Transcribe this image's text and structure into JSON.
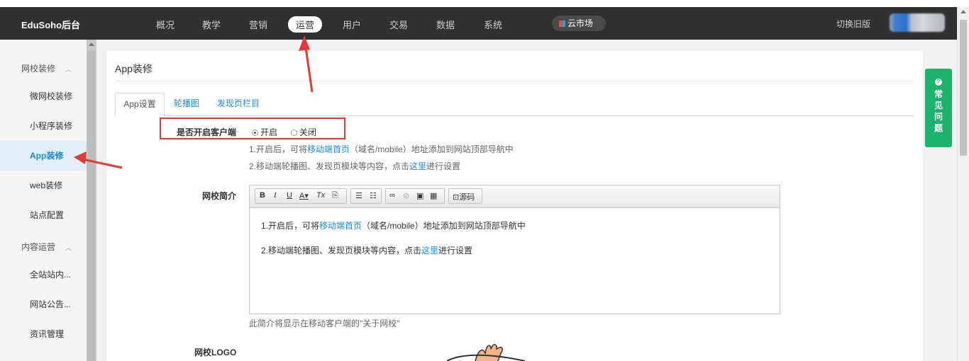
{
  "navbar": {
    "brand": "EduSoho后台",
    "items": [
      "概况",
      "教学",
      "营销",
      "运营",
      "用户",
      "交易",
      "数据",
      "系统"
    ],
    "active": "运营",
    "market": "云市场",
    "switch_old": "切换旧版"
  },
  "sidebar": {
    "group1": "网校装修",
    "items1": [
      "微网校装修",
      "小程序装修",
      "App装修",
      "web装修",
      "站点配置"
    ],
    "active": "App装修",
    "group2": "内容运营",
    "items2": [
      "全站站内...",
      "网站公告...",
      "资讯管理"
    ]
  },
  "panel": {
    "title": "App装修",
    "tabs": [
      "App设置",
      "轮播图",
      "发现页栏目"
    ],
    "active_tab": "App设置",
    "client_label": "是否开启客户端",
    "radio_on": "开启",
    "radio_off": "关闭",
    "radio_selected": "开启",
    "help1_pre": "1.开启后，可将",
    "help1_link": "移动端首页",
    "help1_post": "（域名/mobile）地址添加到网站顶部导航中",
    "help2_pre": "2.移动端轮播图、发现页模块等内容，点击",
    "help2_link": "这里",
    "help2_post": "进行设置",
    "intro_label": "网校简介",
    "editor_source": "源码",
    "editor_line1_pre": "1.开启后，可将",
    "editor_line1_link": "移动端首页",
    "editor_line1_post": "（域名/mobile）地址添加到网站顶部导航中",
    "editor_line2_pre": "2.移动端轮播图、发现页模块等内容，点击",
    "editor_line2_link": "这里",
    "editor_line2_post": "进行设置",
    "editor_note": "此简介将显示在移动客户端的\"关于网校\"",
    "logo_label": "网校LOGO"
  },
  "faq": {
    "label": "常见问题"
  },
  "colors": {
    "navbar_bg": "#303030",
    "accent": "#1a8be0",
    "faq_bg": "#1db36b",
    "annotation": "#e53935"
  }
}
